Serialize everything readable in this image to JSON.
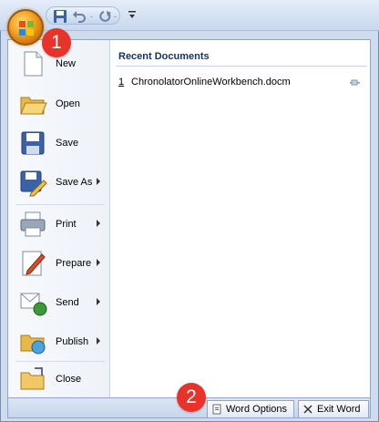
{
  "colors": {
    "accent": "#e8332b",
    "frame": "#cfdcee",
    "text": "#15325d"
  },
  "callouts": {
    "first": "1",
    "second": "2"
  },
  "quick_access": {
    "icons": [
      "save-icon",
      "undo-icon",
      "redo-icon",
      "customize-dropdown-icon"
    ],
    "separator": "-"
  },
  "menu": {
    "commands": [
      {
        "label": "New",
        "icon": "new-document-icon",
        "has_submenu": false
      },
      {
        "label": "Open",
        "icon": "open-folder-icon",
        "has_submenu": false
      },
      {
        "label": "Save",
        "icon": "save-floppy-icon",
        "has_submenu": false
      },
      {
        "label": "Save As",
        "icon": "save-as-icon",
        "has_submenu": true
      },
      {
        "label": "Print",
        "icon": "printer-icon",
        "has_submenu": true
      },
      {
        "label": "Prepare",
        "icon": "prepare-icon",
        "has_submenu": true
      },
      {
        "label": "Send",
        "icon": "send-icon",
        "has_submenu": true
      },
      {
        "label": "Publish",
        "icon": "publish-icon",
        "has_submenu": true
      },
      {
        "label": "Close",
        "icon": "close-folder-icon",
        "has_submenu": false
      }
    ],
    "recent": {
      "header": "Recent Documents",
      "items": [
        {
          "number": "1",
          "name": "ChronolatorOnlineWorkbench.docm"
        }
      ]
    }
  },
  "bottom_buttons": {
    "word_options": "Word Options",
    "exit_word": "Exit Word"
  }
}
